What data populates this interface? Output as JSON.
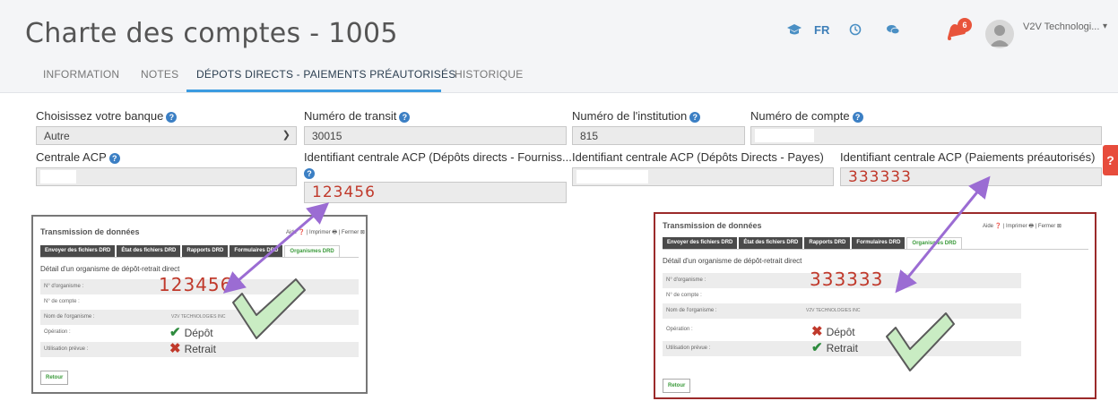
{
  "header": {
    "title": "Charte des comptes - 1005",
    "language": "FR",
    "notification_count": "6",
    "user_name": "V2V Technologi..."
  },
  "tabs": [
    {
      "label": "INFORMATION",
      "active": false
    },
    {
      "label": "NOTES",
      "active": false
    },
    {
      "label": "DÉPOTS DIRECTS - PAIEMENTS PRÉAUTORISÉS",
      "active": true
    },
    {
      "label": "HISTORIQUE",
      "active": false
    }
  ],
  "form": {
    "bank_label": "Choisissez votre banque",
    "bank_value": "Autre",
    "transit_label": "Numéro de transit",
    "transit_value": "30015",
    "institution_label": "Numéro de l'institution",
    "institution_value": "815",
    "account_label": "Numéro de compte",
    "account_value": "",
    "acp_label": "Centrale ACP",
    "acp_value": "",
    "id_supplier_label": "Identifiant centrale ACP (Dépôts directs - Fourniss...",
    "id_supplier_value": "123456",
    "id_payroll_label": "Identifiant centrale ACP (Dépôts Directs - Payes)",
    "id_payroll_value": "",
    "id_preauth_label": "Identifiant centrale ACP (Paiements préautorisés)",
    "id_preauth_value": "333333",
    "side_tab_label": "?"
  },
  "screenshot_left": {
    "title": "Transmission de données",
    "links": "Aide ❓ | Imprimer 🖶 | Fermer ⊠",
    "tabs": [
      "Envoyer des fichiers DRD",
      "État des fichiers DRD",
      "Rapports DRD",
      "Formulaires DRD",
      "Organismes DRD"
    ],
    "heading": "Détail d'un organisme de dépôt-retrait direct",
    "rows": [
      {
        "label": "N° d'organisme :",
        "value": "123456"
      },
      {
        "label": "N° de compte :",
        "value": ""
      },
      {
        "label": "Nom de l'organisme :",
        "value": "V2V TECHNOLOGIES INC"
      },
      {
        "label": "Opération :",
        "value": ""
      },
      {
        "label": "Utilisation prévue :",
        "value": ""
      }
    ],
    "operations": [
      {
        "label": "Dépôt",
        "state": "check"
      },
      {
        "label": "Retrait",
        "state": "cross"
      }
    ],
    "back_button": "Retour"
  },
  "screenshot_right": {
    "title": "Transmission de données",
    "links": "Aide ❓ | Imprimer 🖶 | Fermer ⊠",
    "tabs": [
      "Envoyer des fichiers DRD",
      "État des fichiers DRD",
      "Rapports DRD",
      "Formulaires DRD",
      "Organismes DRD"
    ],
    "heading": "Détail d'un organisme de dépôt-retrait direct",
    "rows": [
      {
        "label": "N° d'organisme :",
        "value": "333333"
      },
      {
        "label": "N° de compte :",
        "value": ""
      },
      {
        "label": "Nom de l'organisme :",
        "value": "V2V TECHNOLOGIES INC"
      },
      {
        "label": "Opération :",
        "value": ""
      },
      {
        "label": "Utilisation prévue :",
        "value": ""
      }
    ],
    "operations": [
      {
        "label": "Dépôt",
        "state": "cross"
      },
      {
        "label": "Retrait",
        "state": "check"
      }
    ],
    "back_button": "Retour"
  },
  "colors": {
    "accent": "#3b9be0",
    "arrow": "#9b6cd3",
    "highlight_value": "#c0392b",
    "check": "#2e8b3e"
  }
}
